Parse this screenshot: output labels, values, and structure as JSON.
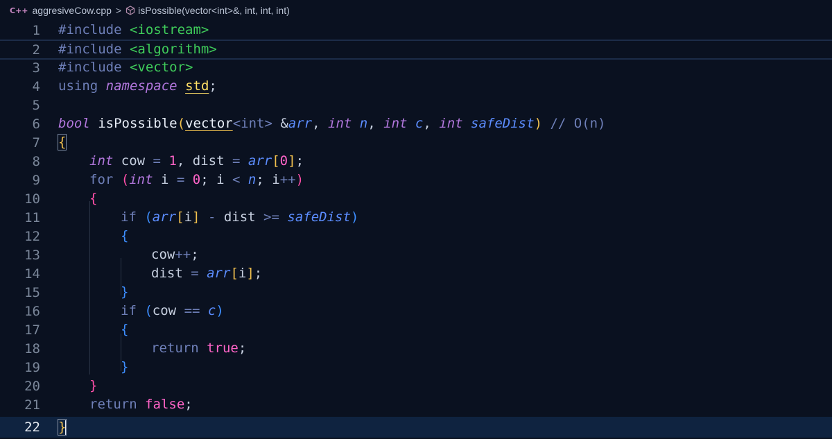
{
  "breadcrumb": {
    "file_icon": "C++",
    "file_name": "aggresiveCow.cpp",
    "separator": ">",
    "symbol_icon": "cube-icon",
    "symbol_name": "isPossible(vector<int>&, int, int, int)"
  },
  "editor": {
    "line_numbers": [
      "1",
      "2",
      "3",
      "4",
      "5",
      "6",
      "7",
      "8",
      "9",
      "10",
      "11",
      "12",
      "13",
      "14",
      "15",
      "16",
      "17",
      "18",
      "19",
      "20",
      "21",
      "22"
    ],
    "current_line": 22,
    "lines": {
      "l1": [
        "#include",
        " ",
        "<iostream>"
      ],
      "l2": [
        "#include",
        " ",
        "<algorithm>"
      ],
      "l3": [
        "#include",
        " ",
        "<vector>"
      ],
      "l4": [
        "using",
        " ",
        "namespace",
        " ",
        "std",
        ";"
      ],
      "l6": [
        "bool",
        " ",
        "isPossible",
        "(",
        "vector",
        "<int>",
        " &",
        "arr",
        ", ",
        "int",
        " ",
        "n",
        ", ",
        "int",
        " ",
        "c",
        ", ",
        "int",
        " ",
        "safeDist",
        ")",
        " ",
        "// O(n)"
      ],
      "l7": [
        "{"
      ],
      "l8": [
        "int",
        " cow ",
        "=",
        " ",
        "1",
        ", dist ",
        "=",
        " ",
        "arr",
        "[",
        "0",
        "]",
        ";"
      ],
      "l9": [
        "for",
        " ",
        "(",
        "int",
        " i ",
        "=",
        " ",
        "0",
        "; i ",
        "<",
        " ",
        "n",
        "; i",
        "++",
        ")"
      ],
      "l10": [
        "{"
      ],
      "l11": [
        "if",
        " ",
        "(",
        "arr",
        "[",
        "i",
        "]",
        " ",
        "-",
        " dist ",
        ">=",
        " ",
        "safeDist",
        ")"
      ],
      "l12": [
        "{"
      ],
      "l13": [
        "cow",
        "++",
        ";"
      ],
      "l14": [
        "dist ",
        "=",
        " ",
        "arr",
        "[",
        "i",
        "]",
        ";"
      ],
      "l15": [
        "}"
      ],
      "l16": [
        "if",
        " ",
        "(",
        "cow ",
        "==",
        " ",
        "c",
        ")"
      ],
      "l17": [
        "{"
      ],
      "l18": [
        "return",
        " ",
        "true",
        ";"
      ],
      "l19": [
        "}"
      ],
      "l20": [
        "}"
      ],
      "l21": [
        "return",
        " ",
        "false",
        ";"
      ],
      "l22": [
        "}"
      ]
    }
  },
  "colors": {
    "background": "#0a1120",
    "current_line": "#0f2340",
    "keyword": "#6e7fb8",
    "include_path": "#3fcc5a",
    "type": "#b277dd",
    "number": "#ff64c8",
    "param": "#5c8dff",
    "bracket_gold": "#f2c14e",
    "bracket_pink": "#ff4fa8",
    "bracket_blue": "#3d8eff"
  }
}
